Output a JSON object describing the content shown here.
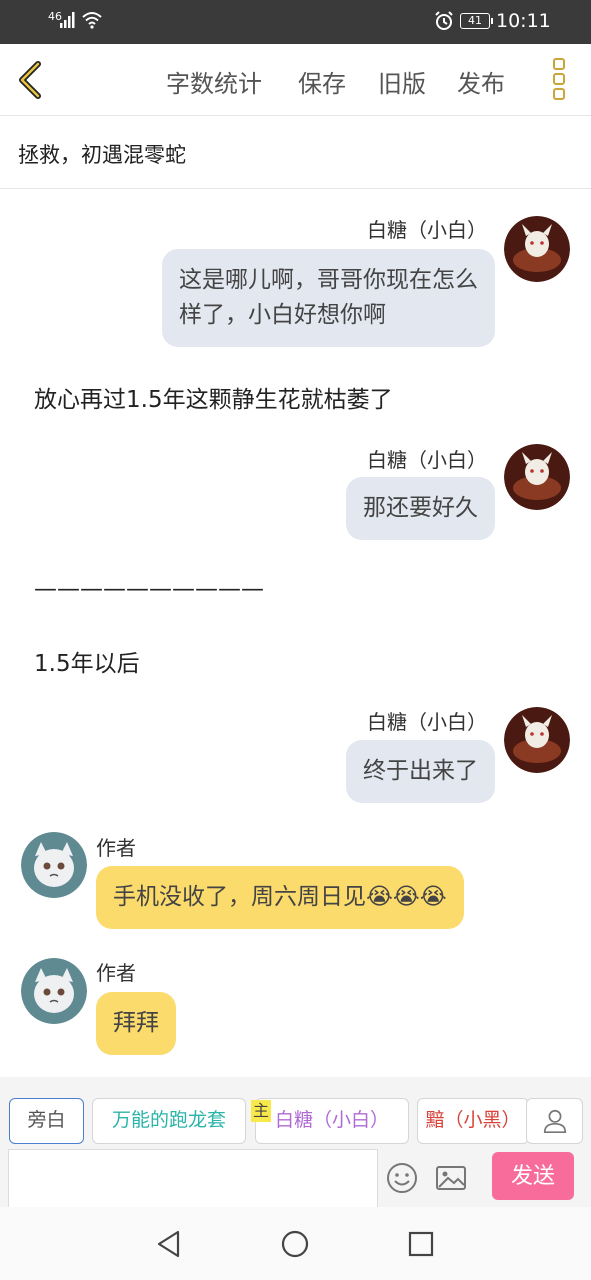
{
  "status": {
    "network": "46",
    "battery": "41",
    "time": "10:11"
  },
  "toolbar": {
    "actions": [
      "字数统计",
      "保存",
      "旧版",
      "发布"
    ]
  },
  "chapter": {
    "title": "拯救，初遇混零蛇"
  },
  "messages": [
    {
      "type": "right",
      "name": "白糖（小白）",
      "text_lines": [
        "这是哪儿啊，哥哥你现在怎么",
        "样了，小白好想你啊"
      ]
    },
    {
      "type": "narration",
      "text": "放心再过1.5年这颗静生花就枯萎了"
    },
    {
      "type": "right",
      "name": "白糖（小白）",
      "text_lines": [
        "那还要好久"
      ]
    },
    {
      "type": "narration",
      "text": "——————————"
    },
    {
      "type": "narration",
      "text": "1.5年以后"
    },
    {
      "type": "right",
      "name": "白糖（小白）",
      "text_lines": [
        "终于出来了"
      ]
    },
    {
      "type": "left",
      "name": "作者",
      "text": "手机没收了，周六周日见😭😭😭"
    },
    {
      "type": "left",
      "name": "作者",
      "text": "拜拜"
    }
  ],
  "roles": [
    "旁白",
    "万能的跑龙套",
    "白糖（小白）",
    "黯（小黑）"
  ],
  "role_colors": {
    "旁白": "#555555",
    "万能的跑龙套": "#2bb5a8",
    "白糖（小白）": "#b06ad6",
    "黯（小黑）": "#d9443a"
  },
  "main_tag": "主",
  "composer": {
    "value": "",
    "send_label": "发送"
  },
  "icons": [
    "back-icon",
    "more-icon",
    "person-icon",
    "emoji-icon",
    "image-icon",
    "nav-back-icon",
    "nav-home-icon",
    "nav-recent-icon"
  ]
}
